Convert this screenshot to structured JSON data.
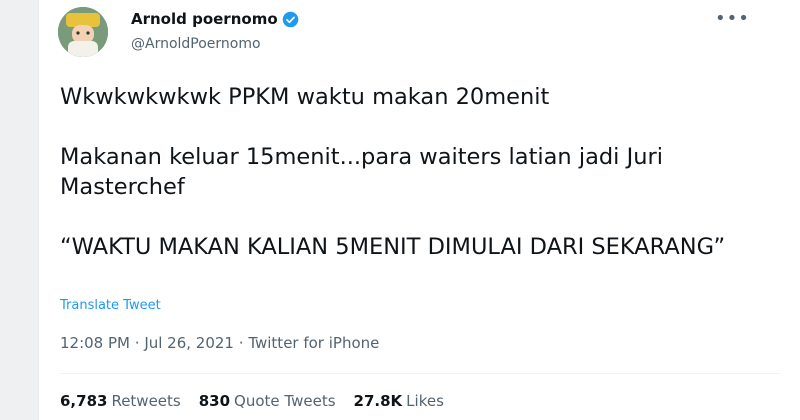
{
  "user": {
    "name": "Arnold poernomo",
    "handle": "@ArnoldPoernomo"
  },
  "tweet": {
    "line1": "Wkwkwkwkwk PPKM waktu makan 20menit",
    "line2": "Makanan keluar 15menit...para waiters latian jadi Juri Masterchef",
    "line3": "“WAKTU MAKAN KALIAN 5MENIT DIMULAI DARI SEKARANG”"
  },
  "translate_label": "Translate Tweet",
  "meta": {
    "time": "12:08 PM",
    "date": "Jul 26, 2021",
    "source": "Twitter for iPhone"
  },
  "stats": {
    "retweets_count": "6,783",
    "retweets_label": "Retweets",
    "quotes_count": "830",
    "quotes_label": "Quote Tweets",
    "likes_count": "27.8K",
    "likes_label": "Likes"
  },
  "colors": {
    "accent": "#1d9bf0",
    "text": "#0f1419",
    "secondary": "#536471"
  },
  "icons": {
    "verified": "verified-badge-icon",
    "more": "more-options-icon"
  }
}
